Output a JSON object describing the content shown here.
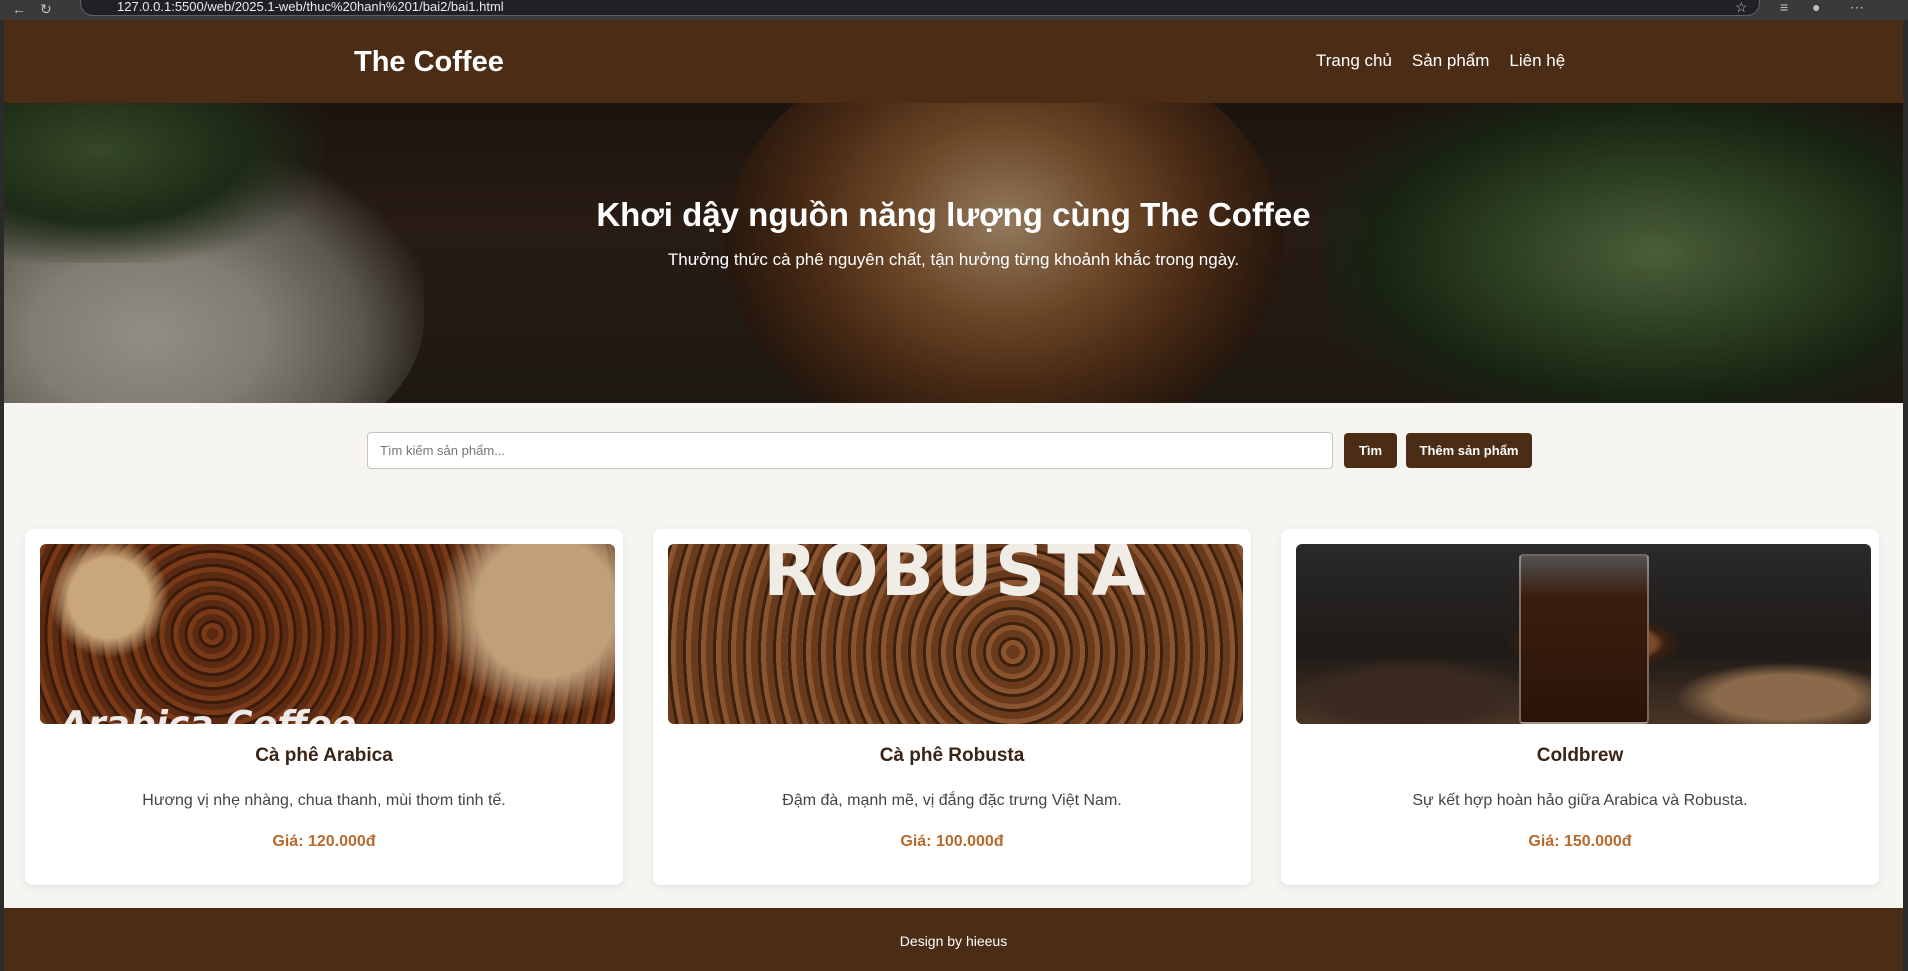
{
  "browser": {
    "url": "127.0.0.1:5500/web/2025.1-web/thuc%20hanh%201/bai2/bai1.html"
  },
  "header": {
    "brand": "The Coffee",
    "nav": [
      "Trang chủ",
      "Sản phẩm",
      "Liên hệ"
    ]
  },
  "hero": {
    "title": "Khơi dậy nguồn năng lượng cùng The Coffee",
    "subtitle": "Thưởng thức cà phê nguyên chất, tận hưởng từng khoảnh khắc trong ngày."
  },
  "search": {
    "placeholder": "Tìm kiếm sản phẩm...",
    "search_label": "Tìm",
    "add_label": "Thêm sản phẩm"
  },
  "products": [
    {
      "name": "Cà phê Arabica",
      "desc": "Hương vị nhẹ nhàng, chua thanh, mùi thơm tinh tế.",
      "price": "Giá: 120.000đ",
      "image_text": "Arabica Coffee"
    },
    {
      "name": "Cà phê Robusta",
      "desc": "Đậm đà, mạnh mẽ, vị đắng đặc trưng Việt Nam.",
      "price": "Giá: 100.000đ",
      "image_text": "ROBUSTA"
    },
    {
      "name": "Coldbrew",
      "desc": "Sự kết hợp hoàn hảo giữa Arabica và Robusta.",
      "price": "Giá: 150.000đ"
    }
  ],
  "footer": {
    "text": "Design by hieeus"
  },
  "colors": {
    "brand_brown": "#4b2c15",
    "price": "#b86a2c",
    "page_bg": "#f7f5f1"
  }
}
